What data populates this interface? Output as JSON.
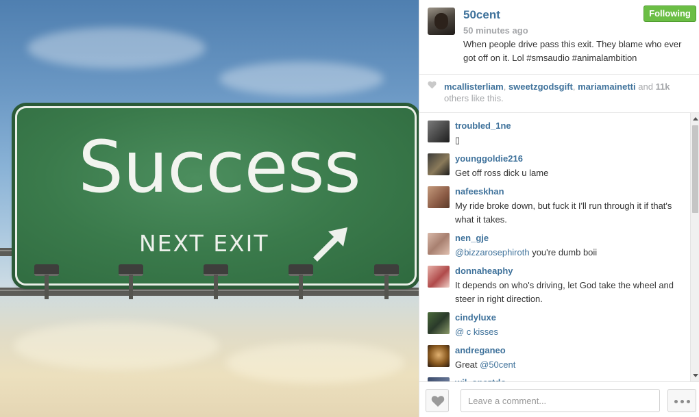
{
  "photo": {
    "sign_word": "Success",
    "sign_subtext": "NEXT EXIT"
  },
  "post": {
    "username": "50cent",
    "follow_label": "Following",
    "time": "50 minutes ago",
    "caption": "When people drive pass this exit. They blame who ever got off on it. Lol #smsaudio #animalambition"
  },
  "likes": {
    "user1": "mcallisterliam",
    "sep1": ", ",
    "user2": "sweetzgodsgift",
    "sep2": ", ",
    "user3": "mariamainetti",
    "and": " and ",
    "count": "11k",
    "suffix": " others like this."
  },
  "comments": [
    {
      "user": "troubled_1ne",
      "text": "▯"
    },
    {
      "user": "younggoldie216",
      "text": "Get off ross dick u lame"
    },
    {
      "user": "nafeeskhan",
      "text": "My ride broke down, but fuck it I'll run through it if that's what it takes."
    },
    {
      "user": "nen_gje",
      "mention": "@bizzarosephiroth",
      "text": " you're dumb boii"
    },
    {
      "user": "donnaheaphy",
      "text": "It depends on who's driving, let God take the wheel and steer in right direction."
    },
    {
      "user": "cindyluxe",
      "mention": "@  c  kisses",
      "text": ""
    },
    {
      "user": "andreganeo",
      "text": "Great ",
      "mention": "@50cent"
    },
    {
      "user": "wil_opeztdo",
      "text": ""
    }
  ],
  "footer": {
    "comment_placeholder": "Leave a comment..."
  },
  "icons": {
    "likes_heart": "heart-icon",
    "like_button": "heart-icon",
    "more_button": "more-dots-icon"
  },
  "colors": {
    "username": "#3f729b",
    "follow_green": "#6bbe45",
    "muted": "#a5a7aa"
  }
}
